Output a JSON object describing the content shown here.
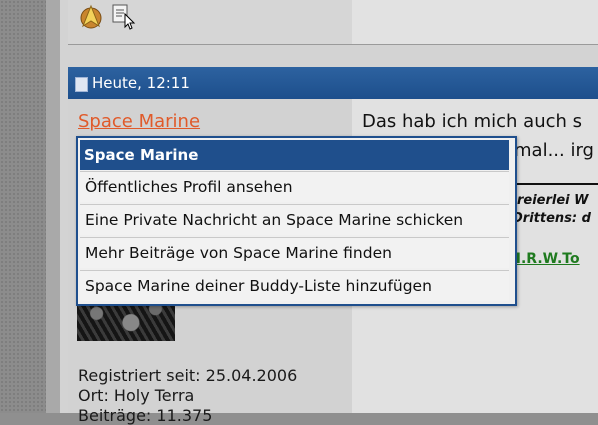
{
  "post": {
    "date": "Heute, 12:11",
    "username": "Space Marine",
    "registered": "Registriert seit: 25.04.2006",
    "location": "Ort: Holy Terra",
    "posts_partial": "Beiträge: 11.375",
    "text_line1": "Das hab ich mich auch s",
    "text_line2": "mal... irg",
    "sig_line1": "reierlei W",
    "sig_line2": "Drittens: d",
    "sig_link": "r I.R.W.To"
  },
  "menu": {
    "title": "Space Marine",
    "items": [
      "Öffentliches Profil ansehen",
      "Eine Private Nachricht an Space Marine schicken",
      "Mehr Beiträge von Space Marine finden",
      "Space Marine deiner Buddy-Liste hinzufügen"
    ]
  },
  "icons": {
    "footer_left": "starfleet-badge-icon",
    "footer_right": "quote-cursor-icon"
  },
  "colors": {
    "header_blue": "#1f4f8c",
    "username_orange": "#e05a2a",
    "link_green": "#1f7a1f"
  }
}
